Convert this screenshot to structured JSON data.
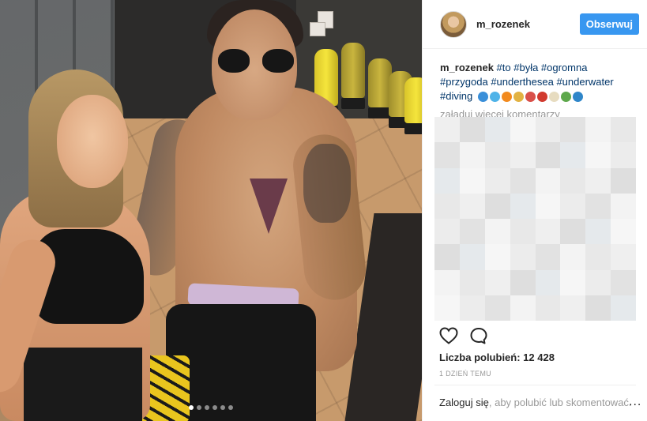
{
  "post": {
    "username": "m_rozenek",
    "follow_label": "Obserwuj",
    "caption_user": "m_rozenek",
    "caption_text": "#to #była #ogromna #przygoda #underthesea #underwater #diving",
    "emojis": [
      {
        "name": "wave-emoji",
        "color": "#3a8fd9"
      },
      {
        "name": "whale-emoji",
        "color": "#4fb3e8"
      },
      {
        "name": "fish-emoji",
        "color": "#f28a1e"
      },
      {
        "name": "blowfish-emoji",
        "color": "#e2b243"
      },
      {
        "name": "octopus-emoji",
        "color": "#d9504a"
      },
      {
        "name": "crab-emoji",
        "color": "#d13a2f"
      },
      {
        "name": "shell-emoji",
        "color": "#e7dcc0"
      },
      {
        "name": "turtle-emoji",
        "color": "#5ea84c"
      },
      {
        "name": "globe-emoji",
        "color": "#2f86c9"
      }
    ],
    "load_more": "załaduj więcej komentarzy",
    "likes_label": "Liczba polubień: 12 428",
    "time_ago": "1 DZIEŃ TEMU",
    "login_link": "Zaloguj się",
    "login_rest": ", aby polubić lub skomentować.",
    "more_label": "...",
    "carousel_dots": 6,
    "carousel_active": 0
  },
  "colors": {
    "accent": "#3897f0",
    "hashtag": "#003569",
    "muted": "#999999"
  },
  "icons": {
    "like": "heart-icon",
    "comment": "comment-icon",
    "more": "more-options-icon"
  }
}
